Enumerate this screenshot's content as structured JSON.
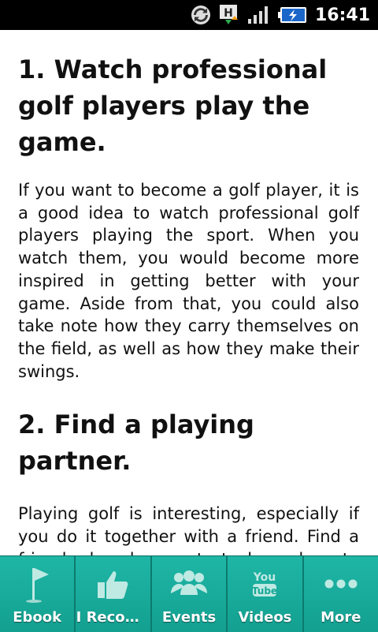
{
  "status_bar": {
    "time": "16:41",
    "icons": [
      "sync-icon",
      "h-plus-data-icon",
      "signal-icon",
      "battery-charging-icon"
    ]
  },
  "article": {
    "sections": [
      {
        "heading": "1. Watch professional golf players play the game.",
        "body": "If you want to become a golf player, it is a good idea to watch professional golf players playing the sport. When you watch them, you would become more inspired in getting better with your game. Aside from that, you could also take note how they carry themselves on the field, as well as how they make their swings."
      },
      {
        "heading": "2. Find a playing partner.",
        "body": "Playing golf is interesting, especially if you do it together with a friend. Find a friend who also wants to learn how to play golf, so that you can each share some pointers. Aside from that, you"
      }
    ]
  },
  "tabs": [
    {
      "label": "Ebook",
      "icon": "flag-icon"
    },
    {
      "label": "I Recom…",
      "icon": "thumbs-up-icon"
    },
    {
      "label": "Events",
      "icon": "people-icon"
    },
    {
      "label": "Videos",
      "icon": "youtube-icon"
    },
    {
      "label": "More",
      "icon": "more-dots-icon"
    }
  ],
  "colors": {
    "tab_bar": "#17a896",
    "status_bar": "#000000",
    "text": "#111111"
  }
}
